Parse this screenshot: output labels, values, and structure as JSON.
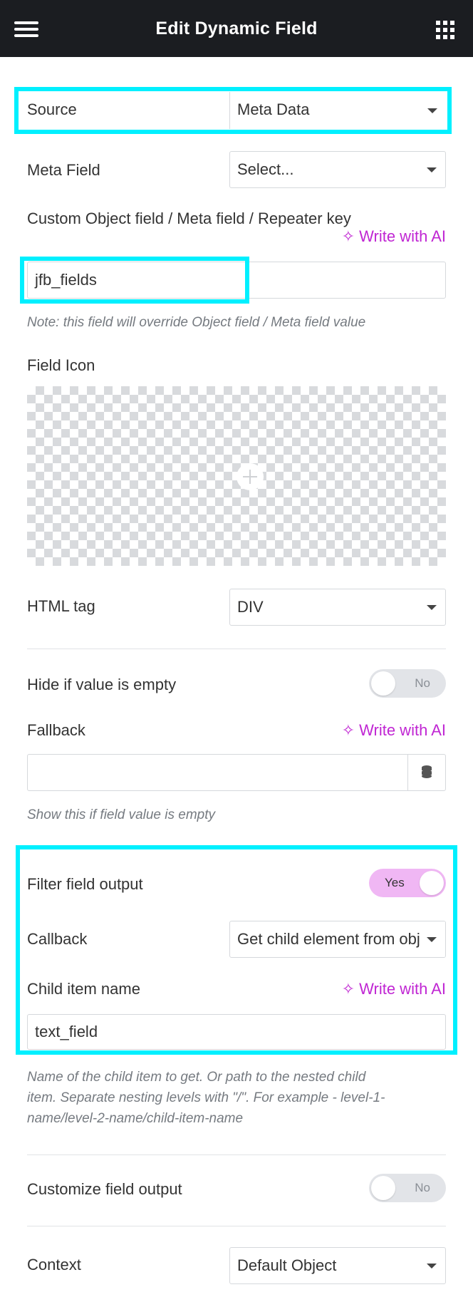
{
  "header": {
    "title": "Edit Dynamic Field"
  },
  "source": {
    "label": "Source",
    "value": "Meta Data"
  },
  "meta_field": {
    "label": "Meta Field",
    "value": "Select..."
  },
  "custom_field": {
    "label": "Custom Object field / Meta field / Repeater key",
    "ai_label": "Write with AI",
    "value": "jfb_fields",
    "note": "Note: this field will override Object field / Meta field value"
  },
  "field_icon": {
    "label": "Field Icon"
  },
  "html_tag": {
    "label": "HTML tag",
    "value": "DIV"
  },
  "hide_empty": {
    "label": "Hide if value is empty",
    "toggle": "No"
  },
  "fallback": {
    "label": "Fallback",
    "ai_label": "Write with AI",
    "value": "",
    "note": "Show this if field value is empty"
  },
  "filter_output": {
    "label": "Filter field output",
    "toggle": "Yes"
  },
  "callback": {
    "label": "Callback",
    "value": "Get child element from object/array"
  },
  "child_item": {
    "label": "Child item name",
    "ai_label": "Write with AI",
    "value": "text_field",
    "note_line1": "Name of the child item to get. Or path to the nested child",
    "note_line2": "item. Separate nesting levels with \"/\". For example - level-1-",
    "note_line3": "name/level-2-name/child-item-name"
  },
  "customize_output": {
    "label": "Customize field output",
    "toggle": "No"
  },
  "context": {
    "label": "Context",
    "value": "Default Object"
  },
  "colors": {
    "highlight": "#00f0ff",
    "ai": "#c026d3",
    "toggle_on": "#f0b7f4",
    "header_bg": "#1b1d21"
  }
}
